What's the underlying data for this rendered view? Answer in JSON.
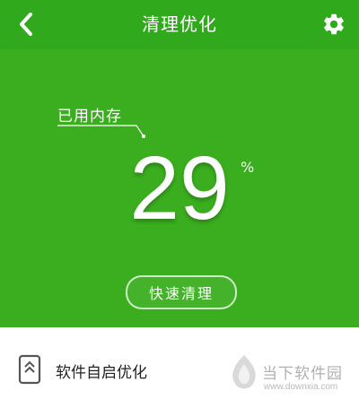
{
  "header": {
    "title": "清理优化",
    "back_icon": "chevron-left-icon",
    "settings_icon": "gear-icon"
  },
  "memory": {
    "label": "已用内存",
    "used_percent": "29",
    "unit": "%",
    "clean_button_label": "快速清理"
  },
  "list": {
    "items": [
      {
        "label": "软件自启优化",
        "icon": "phone-autostart-icon"
      }
    ]
  },
  "watermark": {
    "site_name": "当下软件园",
    "url": "www.downxia.com"
  },
  "colors": {
    "header_green": "#31a91c",
    "hero_green": "#3aae1e",
    "text_white": "#ffffff",
    "list_bg": "#ffffff"
  }
}
